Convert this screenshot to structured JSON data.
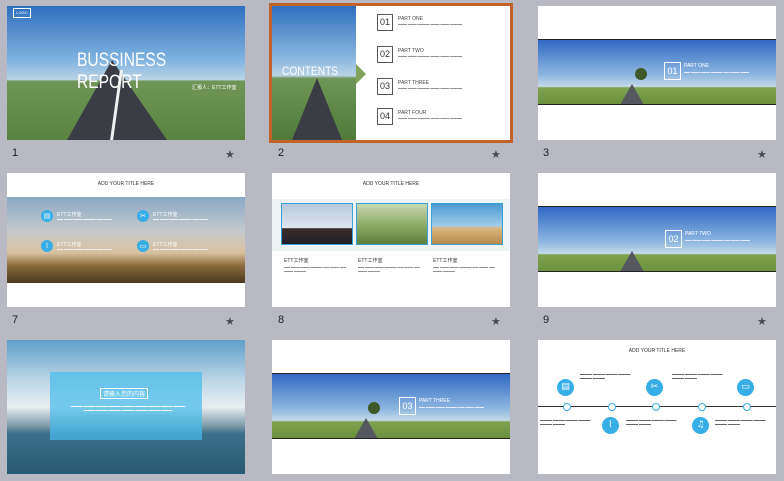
{
  "slides": [
    {
      "number": "1",
      "title": "BUSSINESS REPORT",
      "subtitle": "汇报人：ETT工作室",
      "logo": "LOGO"
    },
    {
      "number": "2",
      "title": "CONTENTS",
      "items": [
        {
          "num": "01",
          "label": "PART ONE"
        },
        {
          "num": "02",
          "label": "PART TWO"
        },
        {
          "num": "03",
          "label": "PART THREE"
        },
        {
          "num": "04",
          "label": "PART FOUR"
        }
      ]
    },
    {
      "number": "3",
      "part_num": "01",
      "part_label": "PART ONE"
    },
    {
      "number": "7",
      "heading": "ADD YOUR TITLE HERE",
      "cards": [
        "ETT工作室",
        "ETT工作室",
        "ETT工作室",
        "ETT工作室"
      ]
    },
    {
      "number": "8",
      "heading": "ADD YOUR TITLE HERE",
      "cols": [
        "ETT工作室",
        "ETT工作室",
        "ETT工作室"
      ]
    },
    {
      "number": "9",
      "part_num": "02",
      "part_label": "PART TWO"
    },
    {
      "number": "",
      "box_title": "请输入您的内容"
    },
    {
      "number": "",
      "part_num": "03",
      "part_label": "PART THREE"
    },
    {
      "number": "",
      "heading": "ADD YOUR TITLE HERE"
    }
  ],
  "icons": {
    "star": "star-icon"
  }
}
